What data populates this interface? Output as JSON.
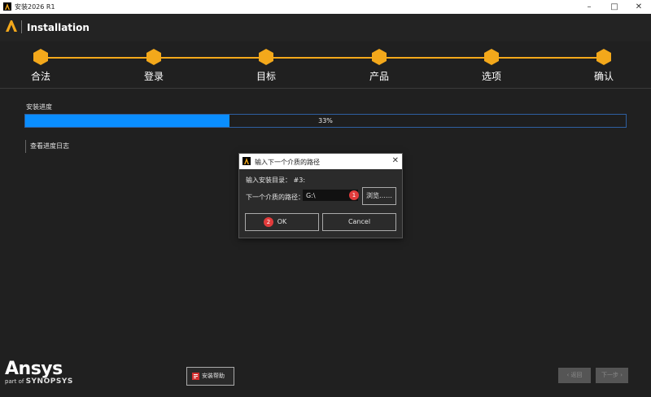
{
  "window": {
    "title": "安装2026 R1"
  },
  "header": {
    "title": "Installation"
  },
  "steps": [
    {
      "label": "合法"
    },
    {
      "label": "登录"
    },
    {
      "label": "目标"
    },
    {
      "label": "产品"
    },
    {
      "label": "选项"
    },
    {
      "label": "确认"
    }
  ],
  "progress": {
    "label": "安装进度",
    "percent_text": "33%",
    "fraction": 0.34
  },
  "log_link": "查看进度日志",
  "dialog": {
    "title": "输入下一个介质的路径",
    "dir_label": "输入安装目录： #3:",
    "path_label": "下一个介质的路径：",
    "path_value": "G:\\",
    "browse_label": "浏览……",
    "ok_label": "OK",
    "cancel_label": "Cancel",
    "badge_1": "1",
    "badge_2": "2"
  },
  "footer": {
    "brand": "Ansys",
    "part_of": "part of",
    "parent": "SYNOPSYS",
    "help_label": "安装帮助",
    "back_label": "返回",
    "next_label": "下一步"
  },
  "colors": {
    "accent": "#f3a81b",
    "progress": "#0a8eff",
    "badge": "#e23b3b"
  },
  "icons": {
    "app": "ansys-logo-icon",
    "close": "close-icon",
    "help": "pdf-help-icon"
  }
}
